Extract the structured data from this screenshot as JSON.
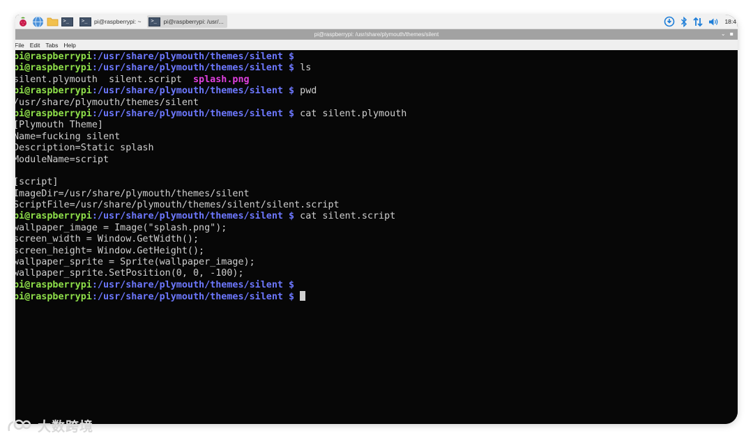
{
  "panel": {
    "launcher_icons": [
      "raspberry-icon",
      "globe-icon",
      "folder-icon",
      "terminal-icon"
    ],
    "tasks": [
      {
        "label": "pi@raspberrypi: ~",
        "active": false
      },
      {
        "label": "pi@raspberrypi: /usr/...",
        "active": true
      }
    ],
    "tray_icons": [
      "update-icon",
      "bluetooth-icon",
      "network-icon",
      "volume-icon"
    ],
    "clock": "18:4"
  },
  "window": {
    "title": "pi@raspberrypi: /usr/share/plymouth/themes/silent",
    "controls": [
      "⌄",
      "▪"
    ]
  },
  "menu": [
    "File",
    "Edit",
    "Tabs",
    "Help"
  ],
  "terminal": {
    "prompt_user": "pi@raspberrypi",
    "prompt_path": ":/usr/share/plymouth/themes/silent $",
    "lines": [
      {
        "type": "prompt",
        "cmd": ""
      },
      {
        "type": "prompt",
        "cmd": " ls"
      },
      {
        "type": "ls",
        "plain": "silent.plymouth  silent.script  ",
        "image": "splash.png"
      },
      {
        "type": "prompt",
        "cmd": " pwd"
      },
      {
        "type": "out",
        "text": "/usr/share/plymouth/themes/silent"
      },
      {
        "type": "prompt",
        "cmd": " cat silent.plymouth"
      },
      {
        "type": "out",
        "text": "[Plymouth Theme]"
      },
      {
        "type": "out",
        "text": "Name=fucking silent"
      },
      {
        "type": "out",
        "text": "Description=Static splash"
      },
      {
        "type": "out",
        "text": "ModuleName=script"
      },
      {
        "type": "out",
        "text": ""
      },
      {
        "type": "out",
        "text": "[script]"
      },
      {
        "type": "out",
        "text": "ImageDir=/usr/share/plymouth/themes/silent"
      },
      {
        "type": "out",
        "text": "ScriptFile=/usr/share/plymouth/themes/silent/silent.script"
      },
      {
        "type": "prompt",
        "cmd": " cat silent.script"
      },
      {
        "type": "out",
        "text": "wallpaper_image = Image(\"splash.png\");"
      },
      {
        "type": "out",
        "text": "screen_width = Window.GetWidth();"
      },
      {
        "type": "out",
        "text": "screen_height= Window.GetHeight();"
      },
      {
        "type": "out",
        "text": "wallpaper_sprite = Sprite(wallpaper_image);"
      },
      {
        "type": "out",
        "text": "wallpaper_sprite.SetPosition(0, 0, -100);"
      },
      {
        "type": "prompt",
        "cmd": ""
      },
      {
        "type": "prompt",
        "cmd": " ",
        "cursor": true
      }
    ]
  },
  "watermark": "大数跨境",
  "colors": {
    "user": "#8fe04a",
    "path": "#6d78ff",
    "image_file": "#e040e0",
    "text": "#cfcfcf",
    "background": "#070707"
  }
}
